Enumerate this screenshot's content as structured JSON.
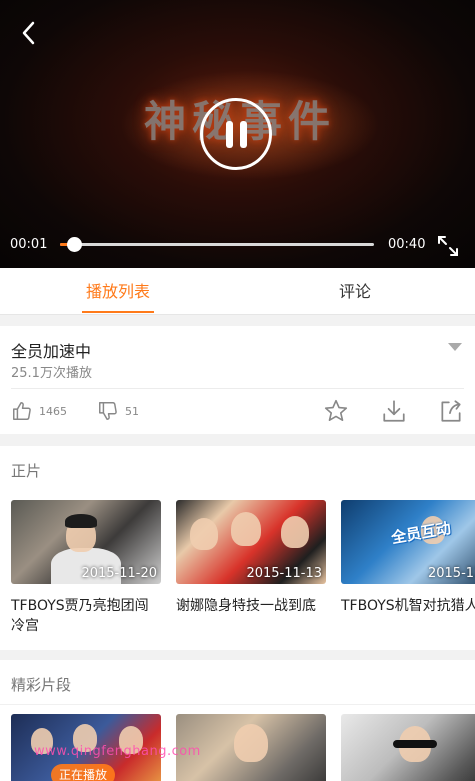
{
  "player": {
    "title_art": "神秘事件",
    "current_time": "00:01",
    "total_time": "00:40",
    "progress": 0.045
  },
  "tabs": [
    {
      "label": "播放列表",
      "active": true
    },
    {
      "label": "评论",
      "active": false
    }
  ],
  "info": {
    "title": "全员加速中",
    "plays": "25.1万次播放",
    "like_count": "1465",
    "dislike_count": "51"
  },
  "sections": {
    "main": {
      "title": "正片",
      "cards": [
        {
          "date": "2015-11-20",
          "title": "TFBOYS贾乃亮抱团闯冷宫"
        },
        {
          "date": "2015-11-13",
          "title": "谢娜隐身特技一战到底"
        },
        {
          "date": "2015-11-",
          "title": "TFBOYS机智对抗猎人"
        }
      ]
    },
    "clips": {
      "title": "精彩片段",
      "playing_label": "正在播放"
    }
  },
  "thumb_badge": "全员互动",
  "watermark": "www.qingfenghang.com",
  "colors": {
    "accent": "#ff7a1a"
  }
}
